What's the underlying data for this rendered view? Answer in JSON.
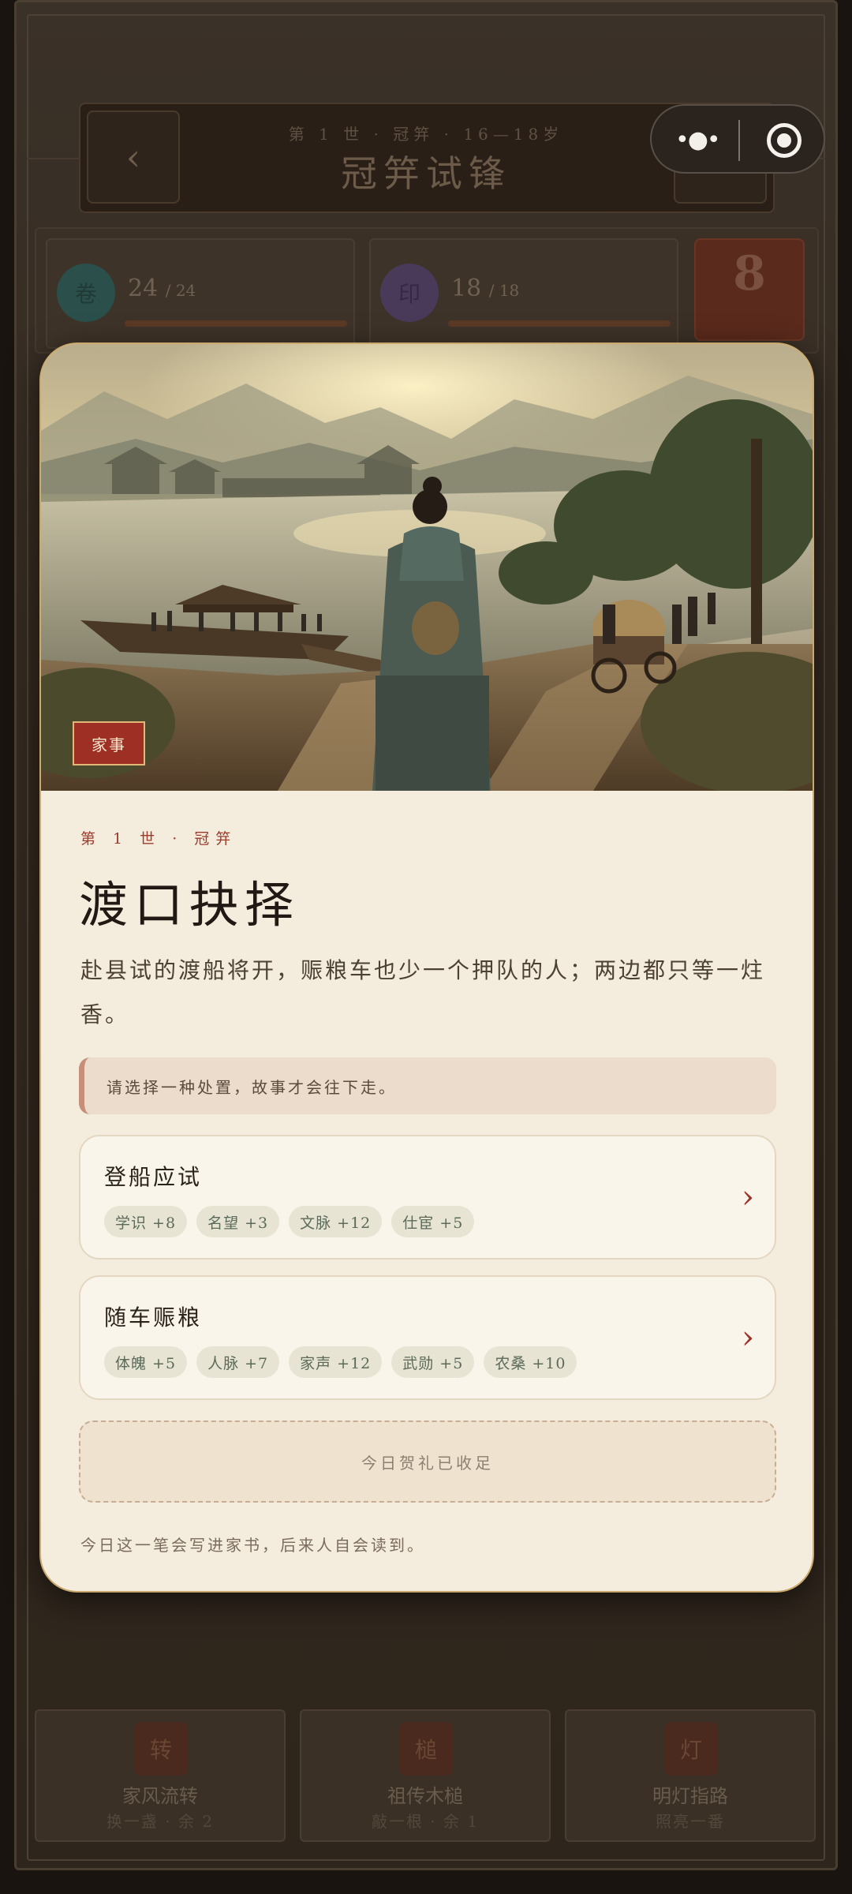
{
  "header": {
    "subtitle": "第 1 世 · 冠笄 · 16—18岁",
    "title": "冠笄试锋",
    "back_icon": "chevron-left-icon",
    "help_label": "?"
  },
  "capsule": {
    "more_icon": "more-dots-icon",
    "close_icon": "record-target-icon"
  },
  "stats": [
    {
      "glyph": "卷",
      "value": "24",
      "max": "/ 24",
      "color": "#2b4f4a"
    },
    {
      "glyph": "印",
      "value": "18",
      "max": "/ 18",
      "color": "#4a3a5a"
    }
  ],
  "counter": "8",
  "tools": [
    {
      "glyph": "转",
      "name": "家风流转",
      "sub": "换一盏 · 余 2"
    },
    {
      "glyph": "槌",
      "name": "祖传木槌",
      "sub": "敲一根 · 余 1"
    },
    {
      "glyph": "灯",
      "name": "明灯指路",
      "sub": "照亮一番"
    }
  ],
  "modal": {
    "tag": "家事",
    "kicker": "第 1 世 · 冠笄",
    "title": "渡口抉择",
    "description": "赴县试的渡船将开，赈粮车也少一个押队的人；两边都只等一炷香。",
    "hint": "请选择一种处置，故事才会往下走。",
    "choices": [
      {
        "title": "登船应试",
        "effects": [
          "学识 +8",
          "名望 +3",
          "文脉 +12",
          "仕宦 +5"
        ]
      },
      {
        "title": "随车赈粮",
        "effects": [
          "体魄 +5",
          "人脉 +7",
          "家声 +12",
          "武勋 +5",
          "农桑 +10"
        ]
      }
    ],
    "gift_status": "今日贺礼已收足",
    "footer_note": "今日这一笔会写进家书，后来人自会读到。"
  },
  "colors": {
    "accent_red": "#9e2f24",
    "card_bg": "#f4ecdc",
    "gold_border": "#c9a96e"
  }
}
